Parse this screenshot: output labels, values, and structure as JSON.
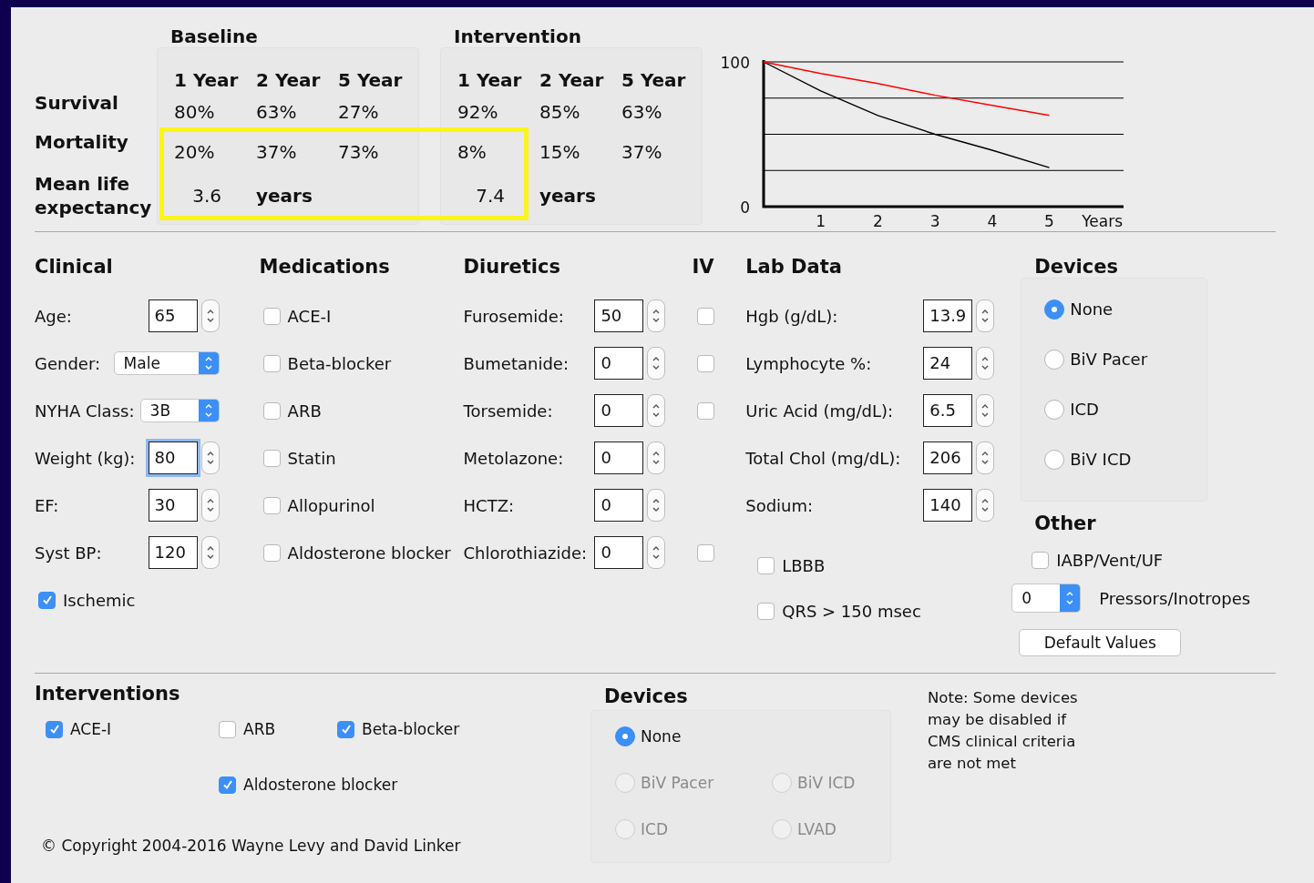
{
  "summary": {
    "row_labels": [
      "Survival",
      "Mortality",
      "Mean life expectancy"
    ],
    "groups": [
      {
        "title": "Baseline",
        "columns": [
          "1 Year",
          "2 Year",
          "5 Year"
        ],
        "survival": [
          "80%",
          "63%",
          "27%"
        ],
        "mortality": [
          "20%",
          "37%",
          "73%"
        ],
        "life_expectancy": "3.6",
        "unit": "years"
      },
      {
        "title": "Intervention",
        "columns": [
          "1 Year",
          "2 Year",
          "5 Year"
        ],
        "survival": [
          "92%",
          "85%",
          "63%"
        ],
        "mortality": [
          "8%",
          "15%",
          "37%"
        ],
        "life_expectancy": "7.4",
        "unit": "years"
      }
    ],
    "highlight": true,
    "chart_data": {
      "type": "line",
      "xlabel": "Years",
      "x": [
        0,
        1,
        2,
        3,
        4,
        5
      ],
      "xlim": [
        0,
        6.3
      ],
      "ylim": [
        0,
        100
      ],
      "xticks": [
        1,
        2,
        3,
        4,
        5
      ],
      "yticks": [
        0,
        100
      ],
      "series": [
        {
          "color": "#000000",
          "values": [
            100,
            80,
            63,
            50,
            39,
            27
          ]
        },
        {
          "color": "#ff0000",
          "values": [
            100,
            92,
            85,
            77,
            70,
            63
          ]
        }
      ]
    }
  },
  "clinical": {
    "title": "Clinical",
    "fields": [
      {
        "kind": "spinner",
        "label": "Age:",
        "value": "65",
        "focused": false
      },
      {
        "kind": "select",
        "label": "Gender:",
        "value": "Male"
      },
      {
        "kind": "select",
        "label": "NYHA Class:",
        "value": "3B"
      },
      {
        "kind": "spinner",
        "label": "Weight (kg):",
        "value": "80",
        "focused": true
      },
      {
        "kind": "spinner",
        "label": "EF:",
        "value": "30",
        "focused": false
      },
      {
        "kind": "spinner",
        "label": "Syst BP:",
        "value": "120",
        "focused": false
      },
      {
        "kind": "checkbox",
        "label": "Ischemic",
        "checked": true
      }
    ]
  },
  "medications": {
    "title": "Medications",
    "items": [
      {
        "label": "ACE-I",
        "checked": false
      },
      {
        "label": "Beta-blocker",
        "checked": false
      },
      {
        "label": "ARB",
        "checked": false
      },
      {
        "label": "Statin",
        "checked": false
      },
      {
        "label": "Allopurinol",
        "checked": false
      },
      {
        "label": "Aldosterone blocker",
        "checked": false
      }
    ]
  },
  "diuretics": {
    "title": "Diuretics",
    "iv_title": "IV",
    "items": [
      {
        "label": "Furosemide:",
        "value": "50",
        "iv": false
      },
      {
        "label": "Bumetanide:",
        "value": "0",
        "iv": false
      },
      {
        "label": "Torsemide:",
        "value": "0",
        "iv": false
      },
      {
        "label": "Metolazone:",
        "value": "0"
      },
      {
        "label": "HCTZ:",
        "value": "0"
      },
      {
        "label": "Chlorothiazide:",
        "value": "0",
        "iv": false
      }
    ]
  },
  "lab_data": {
    "title": "Lab Data",
    "fields": [
      {
        "label": "Hgb (g/dL):",
        "value": "13.9"
      },
      {
        "label": "Lymphocyte %:",
        "value": "24"
      },
      {
        "label": "Uric Acid (mg/dL):",
        "value": "6.5"
      },
      {
        "label": "Total Chol (mg/dL):",
        "value": "206"
      },
      {
        "label": "Sodium:",
        "value": "140"
      }
    ],
    "checks": [
      {
        "label": "LBBB",
        "checked": false
      },
      {
        "label": "QRS > 150 msec",
        "checked": false
      }
    ]
  },
  "devices": {
    "title": "Devices",
    "options": [
      {
        "label": "None",
        "selected": true
      },
      {
        "label": "BiV Pacer",
        "selected": false
      },
      {
        "label": "ICD",
        "selected": false
      },
      {
        "label": "BiV ICD",
        "selected": false
      }
    ]
  },
  "other": {
    "title": "Other",
    "items": [
      {
        "kind": "checkbox",
        "label": "IABP/Vent/UF",
        "checked": false
      },
      {
        "kind": "select",
        "value": "0",
        "label": "Pressors/Inotropes"
      }
    ],
    "button": "Default Values"
  },
  "interventions": {
    "title": "Interventions",
    "items": [
      {
        "label": "ACE-I",
        "checked": true
      },
      {
        "label": "ARB",
        "checked": false
      },
      {
        "label": "Beta-blocker",
        "checked": true
      },
      {
        "label": "Aldosterone blocker",
        "checked": true
      }
    ]
  },
  "intervention_devices": {
    "title": "Devices",
    "options": [
      {
        "label": "None",
        "selected": true,
        "disabled": false
      },
      {
        "label": "BiV Pacer",
        "selected": false,
        "disabled": true
      },
      {
        "label": "BiV ICD",
        "selected": false,
        "disabled": true
      },
      {
        "label": "ICD",
        "selected": false,
        "disabled": true
      },
      {
        "label": "LVAD",
        "selected": false,
        "disabled": true
      }
    ]
  },
  "note": "Note: Some devices may be disabled if CMS clinical criteria are not met",
  "copyright": "© Copyright 2004-2016 Wayne Levy and David Linker"
}
